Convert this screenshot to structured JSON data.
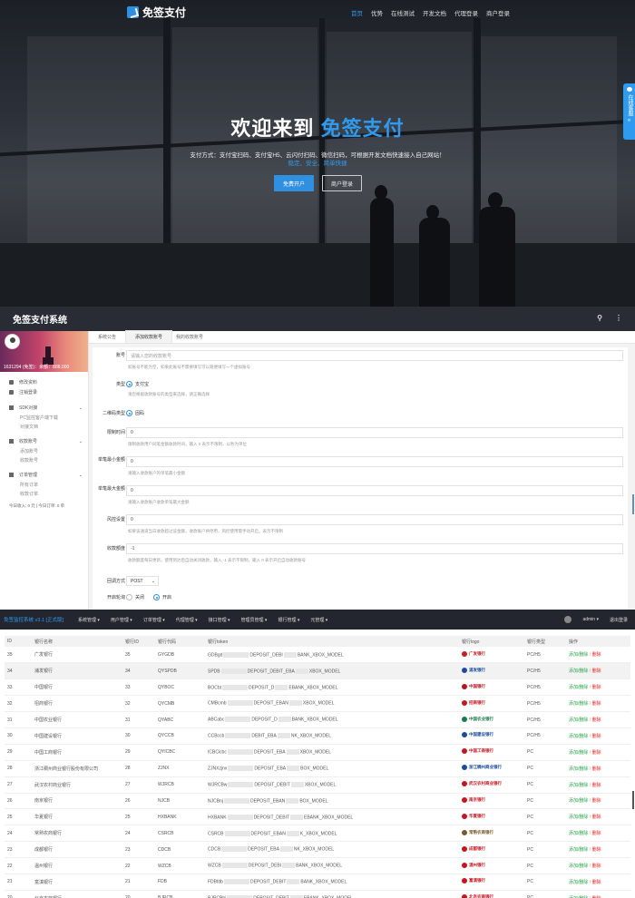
{
  "hero": {
    "brand": "免签支付",
    "nav": [
      "首页",
      "优势",
      "在线测试",
      "开发文档",
      "代理登录",
      "商户登录"
    ],
    "title_main": "欢迎来到",
    "title_accent": "免签支付",
    "subtitle": "支付方式：支付宝扫码、支付宝H5、云闪付扫码、微信扫码，可根据开发文档快速接入自己网站！",
    "subtitle_links": "稳定、安全、简单快捷",
    "btn_register": "免费开户",
    "btn_login": "商户登录",
    "online_service": "在线客服"
  },
  "admin": {
    "title": "免签支付系统",
    "profile_balance": "1631294 (免签)：余额：888.000",
    "menu": [
      {
        "label": "修改资料",
        "type": "item"
      },
      {
        "label": "注销登录",
        "type": "item"
      },
      {
        "label": "SDK对接",
        "type": "group"
      },
      {
        "label": "PC监控客户端下载",
        "type": "sub"
      },
      {
        "label": "对接文档",
        "type": "sub"
      },
      {
        "label": "收款账号",
        "type": "group"
      },
      {
        "label": "添加账号",
        "type": "sub"
      },
      {
        "label": "收款账号",
        "type": "sub"
      },
      {
        "label": "订单管理",
        "type": "group"
      },
      {
        "label": "所有订单",
        "type": "sub"
      },
      {
        "label": "收款订单",
        "type": "sub"
      }
    ],
    "footer_stats": "今日收入: 0 元 | 今日订单: 0 单",
    "tabs": [
      "系统公告",
      "添加收款账号",
      "我的收款账号"
    ],
    "form": {
      "account_label": "账号",
      "account_placeholder": "请输入您的收款账号",
      "account_help": "如账号不能为空，如果此账号不需要填写可以随便填写一个虚拟账号",
      "type_label": "类型",
      "type_option": "支付宝",
      "type_help": "请您根据收款账号的类型来选择，请正确选择",
      "qrcode_label": "二维码类型",
      "qrcode_option": "固码",
      "timeout_label": "限制时间",
      "timeout_value": "0",
      "timeout_help": "限制收款用户同笔金额收款时间，输入 0 表示不限制，以秒为单位",
      "min_label": "单笔最小金额",
      "min_value": "0",
      "min_help": "请输入收款账户的单笔最小金额",
      "max_label": "单笔最大金额",
      "max_value": "0",
      "max_help": "请输入收款账户收款单笔最大金额",
      "risk_label": "风控设置",
      "risk_value": "0",
      "risk_help": "如果该通道当日收款超过该金额，收款账户将停用，风控使用需手动开启，表示不限制",
      "limit_label": "收款额度",
      "limit_value": "-1",
      "limit_help": "收款额度每日更新，使用到达后自动关闭收款，输入 -1 表示不限制，输入 0 表示开启自动收款账号",
      "callback_label": "回调方式",
      "callback_value": "POST",
      "switch_label": "开启轮询",
      "switch_off": "关闭",
      "switch_on": "开启"
    }
  },
  "bank": {
    "system": "免签监控系统 v3.1 [正式版]",
    "menu": [
      "系统管理 ▾",
      "用户管理 ▾",
      "订单管理 ▾",
      "代理管理 ▾",
      "接口管理 ▾",
      "管理员管理 ▾",
      "银行管理 ▾",
      "元管理 ▾"
    ],
    "user": "admin ▾",
    "logout": "退出登录",
    "headers": [
      "ID",
      "银行名称",
      "银行ID",
      "银行代码",
      "银行token",
      "银行logo",
      "银行类型",
      "操作"
    ],
    "rows": [
      {
        "id": "35",
        "name": "广发银行",
        "bid": "35",
        "code": "GYGDB",
        "t1": "GDBgd",
        "t2": "DEPOSIT_DEBI",
        "t3": "BANK_XBOX_MODEL",
        "logo": "广发银行",
        "type": "PC/H5",
        "op1": "添加/删除",
        "op2": "删除"
      },
      {
        "id": "34",
        "name": "浦发银行",
        "bid": "34",
        "code": "QYSPDB",
        "t1": "SPDB",
        "t2": "DEPOSIT_DEBIT_EBA",
        "t3": "XBOX_MODEL",
        "logo": "浦发银行",
        "type": "PC/H5",
        "op1": "添加/删除",
        "op2": "删除"
      },
      {
        "id": "33",
        "name": "中国银行",
        "bid": "33",
        "code": "QYBOC",
        "t1": "BOCbt",
        "t2": "DEPOSIT_D",
        "t3": "EBANK_XBOX_MODEL",
        "logo": "中国银行",
        "type": "PC/H5",
        "op1": "添加/删除",
        "op2": "删除"
      },
      {
        "id": "32",
        "name": "招商银行",
        "bid": "32",
        "code": "QYCMB",
        "t1": "CMBcmb",
        "t2": "DEPOSIT_EBAN",
        "t3": "XBOX_MODEL",
        "logo": "招商银行",
        "type": "PC/H5",
        "op1": "添加/删除",
        "op2": "删除"
      },
      {
        "id": "31",
        "name": "中国农业银行",
        "bid": "31",
        "code": "QYABC",
        "t1": "ABCabc",
        "t2": "DEPOSIT_D",
        "t3": "BANK_XBOX_MODEL",
        "logo": "中国农业银行",
        "type": "PC/H5",
        "op1": "添加/删除",
        "op2": "删除"
      },
      {
        "id": "30",
        "name": "中国建设银行",
        "bid": "30",
        "code": "QYCCB",
        "t1": "CCBccb",
        "t2": "DEBIT_EBA",
        "t3": "NK_XBOX_MODEL",
        "logo": "中国建设银行",
        "type": "PC/H5",
        "op1": "添加/删除",
        "op2": "删除"
      },
      {
        "id": "29",
        "name": "中国工商银行",
        "bid": "29",
        "code": "QYICBC",
        "t1": "ICBCicbc",
        "t2": "DEPOSIT_EBA",
        "t3": "XBOX_MODEL",
        "logo": "中国工商银行",
        "type": "PC",
        "op1": "添加/删除",
        "op2": "删除"
      },
      {
        "id": "28",
        "name": "浙江稠州商业银行股份有限公司",
        "bid": "28",
        "code": "ZJNX",
        "t1": "ZJNXzjnx",
        "t2": "DEPOSIT_EBA",
        "t3": "BOX_MODEL",
        "logo": "浙江稠州商业银行",
        "type": "PC",
        "op1": "添加/删除",
        "op2": "删除"
      },
      {
        "id": "27",
        "name": "武汉农村商业银行",
        "bid": "27",
        "code": "WJRCB",
        "t1": "WJRCBw",
        "t2": "DEPOSIT_DEBIT",
        "t3": "XBOX_MODEL",
        "logo": "武汉农村商业银行",
        "type": "PC",
        "op1": "添加/删除",
        "op2": "删除"
      },
      {
        "id": "26",
        "name": "南京银行",
        "bid": "26",
        "code": "NJCB",
        "t1": "NJCBnj",
        "t2": "DEPOSIT_EBAN",
        "t3": "BOX_MODEL",
        "logo": "南京银行",
        "type": "PC",
        "op1": "添加/删除",
        "op2": "删除"
      },
      {
        "id": "25",
        "name": "华夏银行",
        "bid": "25",
        "code": "HXBANK",
        "t1": "HXBANK",
        "t2": "DEPOSIT_DEBIT",
        "t3": "EBANK_XBOX_MODEL",
        "logo": "华夏银行",
        "type": "PC",
        "op1": "添加/删除",
        "op2": "删除"
      },
      {
        "id": "24",
        "name": "常熟农商银行",
        "bid": "24",
        "code": "CSRCB",
        "t1": "CSRCB",
        "t2": "DEPOSIT_EBAN",
        "t3": "K_XBOX_MODEL",
        "logo": "常熟农商银行",
        "type": "PC",
        "op1": "添加/删除",
        "op2": "删除"
      },
      {
        "id": "23",
        "name": "成都银行",
        "bid": "23",
        "code": "CDCB",
        "t1": "CDCB",
        "t2": "DEPOSIT_EBA",
        "t3": "NK_XBOX_MODEL",
        "logo": "成都银行",
        "type": "PC",
        "op1": "添加/删除",
        "op2": "删除"
      },
      {
        "id": "22",
        "name": "温州银行",
        "bid": "22",
        "code": "WZCB",
        "t1": "WZCB",
        "t2": "DEPOSIT_DEBI",
        "t3": "BANK_XBOX_MODEL",
        "logo": "温州银行",
        "type": "PC",
        "op1": "添加/删除",
        "op2": "删除"
      },
      {
        "id": "21",
        "name": "富滇银行",
        "bid": "21",
        "code": "FDB",
        "t1": "FDBfdb",
        "t2": "DEPOSIT_DEBIT",
        "t3": "BANK_XBOX_MODEL",
        "logo": "富滇银行",
        "type": "PC",
        "op1": "添加/删除",
        "op2": "删除"
      },
      {
        "id": "20",
        "name": "北京农商银行",
        "bid": "20",
        "code": "BJRCB",
        "t1": "BJRCBbj",
        "t2": "DEPOSIT_DEBIT",
        "t3": "EBANK_XBOX_MODEL",
        "logo": "北京农商银行",
        "type": "PC",
        "op1": "添加/删除",
        "op2": "删除"
      }
    ]
  },
  "colors": {
    "accent": "#2f9bf0",
    "admin_bar": "#2a2c35",
    "bank_nav": "#23262e",
    "ok_green": "#2aa14a",
    "danger_red": "#e22222"
  }
}
